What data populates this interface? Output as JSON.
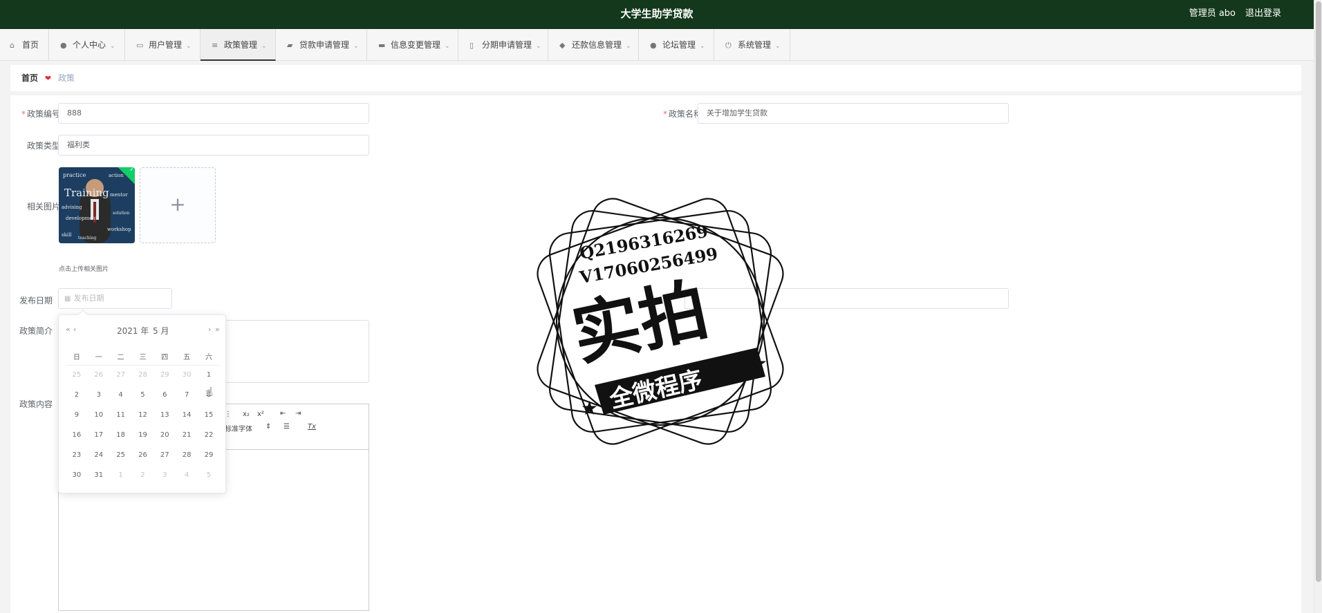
{
  "header": {
    "title": "大学生助学贷款",
    "user": "管理员 abo",
    "logout": "退出登录"
  },
  "nav": [
    {
      "label": "首页",
      "icon": "home-icon",
      "chevron": false
    },
    {
      "label": "个人中心",
      "icon": "user-icon",
      "chevron": true
    },
    {
      "label": "用户管理",
      "icon": "chat-icon",
      "chevron": true
    },
    {
      "label": "政策管理",
      "icon": "list-icon",
      "chevron": true
    },
    {
      "label": "贷款申请管理",
      "icon": "money-icon",
      "chevron": true
    },
    {
      "label": "信息变更管理",
      "icon": "folder-icon",
      "chevron": true
    },
    {
      "label": "分期申请管理",
      "icon": "mic-icon",
      "chevron": true
    },
    {
      "label": "还款信息管理",
      "icon": "location-icon",
      "chevron": true
    },
    {
      "label": "论坛管理",
      "icon": "user-icon",
      "chevron": true
    },
    {
      "label": "系统管理",
      "icon": "power-icon",
      "chevron": true
    }
  ],
  "breadcrumb": {
    "home": "首页",
    "current": "政策"
  },
  "form": {
    "policy_no_label": "政策编号",
    "policy_no_value": "888",
    "policy_name_label": "政策名称",
    "policy_name_value": "关于增加学生贷款",
    "policy_type_label": "政策类型",
    "policy_type_value": "福利类",
    "image_label": "相关图片",
    "upload_tip": "点击上传相关图片",
    "date_label": "发布日期",
    "date_placeholder": "发布日期",
    "intro_label": "政策简介",
    "content_label": "政策内容"
  },
  "editor": {
    "font_label": "标准字体",
    "subscript": "x₂",
    "superscript": "x²",
    "clear_format": "Tx"
  },
  "datepicker": {
    "year_label": "2021 年",
    "month_label": "5 月",
    "prev_year": "«",
    "prev_month": "‹",
    "next_month": "›",
    "next_year": "»",
    "weekdays": [
      "日",
      "一",
      "二",
      "三",
      "四",
      "五",
      "六"
    ],
    "weeks": [
      [
        {
          "d": "25",
          "off": true
        },
        {
          "d": "26",
          "off": true
        },
        {
          "d": "27",
          "off": true
        },
        {
          "d": "28",
          "off": true
        },
        {
          "d": "29",
          "off": true
        },
        {
          "d": "30",
          "off": true
        },
        {
          "d": "1",
          "off": false
        }
      ],
      [
        {
          "d": "2",
          "off": false
        },
        {
          "d": "3",
          "off": false
        },
        {
          "d": "4",
          "off": false
        },
        {
          "d": "5",
          "off": false
        },
        {
          "d": "6",
          "off": false
        },
        {
          "d": "7",
          "off": false
        },
        {
          "d": "8",
          "off": false
        }
      ],
      [
        {
          "d": "9",
          "off": false
        },
        {
          "d": "10",
          "off": false
        },
        {
          "d": "11",
          "off": false
        },
        {
          "d": "12",
          "off": false
        },
        {
          "d": "13",
          "off": false
        },
        {
          "d": "14",
          "off": false
        },
        {
          "d": "15",
          "off": false
        }
      ],
      [
        {
          "d": "16",
          "off": false
        },
        {
          "d": "17",
          "off": false
        },
        {
          "d": "18",
          "off": false
        },
        {
          "d": "19",
          "off": false
        },
        {
          "d": "20",
          "off": false
        },
        {
          "d": "21",
          "off": false
        },
        {
          "d": "22",
          "off": false
        }
      ],
      [
        {
          "d": "23",
          "off": false
        },
        {
          "d": "24",
          "off": false
        },
        {
          "d": "25",
          "off": false
        },
        {
          "d": "26",
          "off": false
        },
        {
          "d": "27",
          "off": false
        },
        {
          "d": "28",
          "off": false
        },
        {
          "d": "29",
          "off": false
        }
      ],
      [
        {
          "d": "30",
          "off": false
        },
        {
          "d": "31",
          "off": false
        },
        {
          "d": "1",
          "off": true
        },
        {
          "d": "2",
          "off": true
        },
        {
          "d": "3",
          "off": true
        },
        {
          "d": "4",
          "off": true
        },
        {
          "d": "5",
          "off": true
        }
      ]
    ]
  },
  "photo_words": [
    "practice",
    "action",
    "Training",
    "mentor",
    "advising",
    "development",
    "solution",
    "workshop",
    "skill",
    "teaching"
  ],
  "stamp": {
    "qq": "Q2196316269",
    "wx": "V17060256499",
    "main": "实拍",
    "sub": "全微程序"
  },
  "colors": {
    "header_bg": "#14381b",
    "required": "#f56c6c",
    "upload_ok": "#13ce66"
  }
}
